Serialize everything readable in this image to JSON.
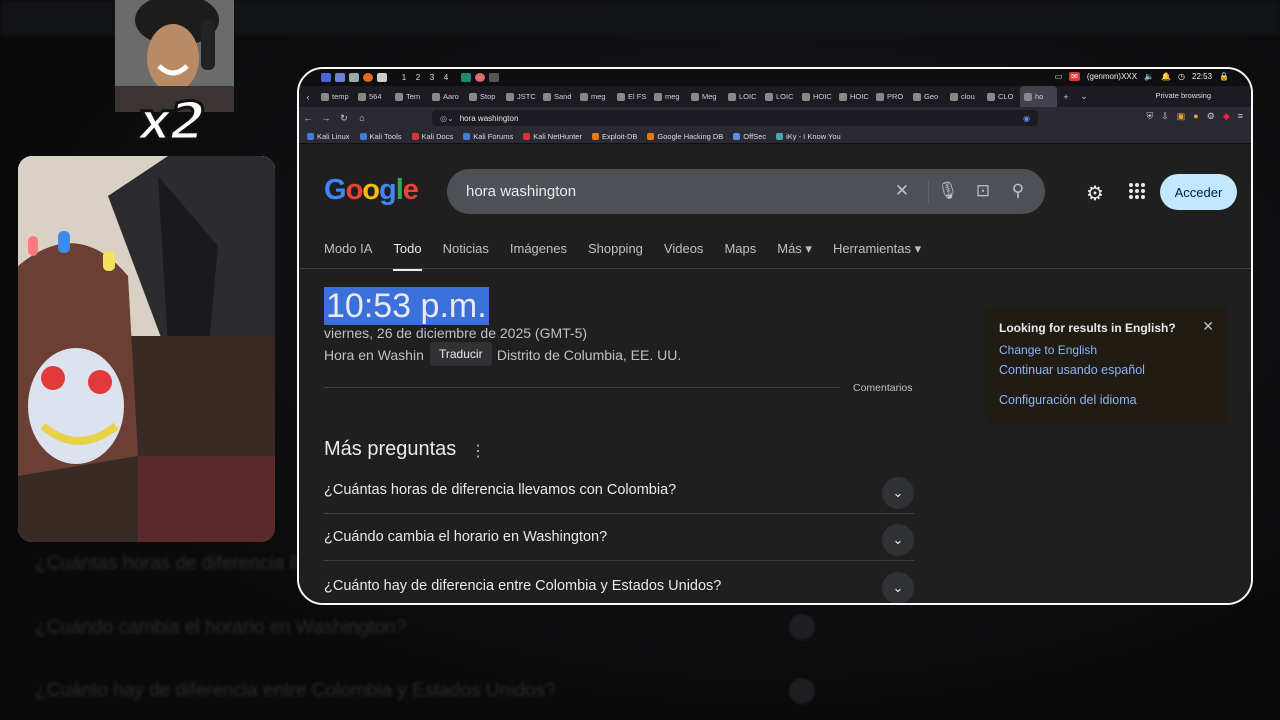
{
  "overlay": {
    "multiplier": "x2"
  },
  "taskbar": {
    "workspaces": [
      "1",
      "2",
      "3",
      "4"
    ],
    "genmon": "(genmon)XXX",
    "time": "22:53"
  },
  "browser": {
    "tabs": [
      "temp",
      "564",
      "Tem",
      "Aaro",
      "Stop",
      "JSTC",
      "Sand",
      "meg",
      "El FS",
      "meg",
      "Meg",
      "LOIC",
      "LOIC",
      "HOIC",
      "HOIC",
      "PRO",
      "Geo",
      "clou",
      "CLO",
      "ho"
    ],
    "active_tab_index": 19,
    "private_label": "Private browsing",
    "url": "hora washington",
    "bookmarks": [
      "Kali Linux",
      "Kali Tools",
      "Kali Docs",
      "Kali Forums",
      "Kali NetHunter",
      "Exploit-DB",
      "Google Hacking DB",
      "OffSec",
      "iKy - I Know You"
    ],
    "bookmark_colors": [
      "#3f7fd9",
      "#3f7fd9",
      "#d33",
      "#3f7fd9",
      "#d33",
      "#e57a12",
      "#e57a12",
      "#5b8fe0",
      "#4aa"
    ]
  },
  "google": {
    "logo_letters": [
      "G",
      "o",
      "o",
      "g",
      "l",
      "e"
    ],
    "query": "hora washington",
    "signin_label": "Acceder",
    "nav_tabs": [
      "Modo IA",
      "Todo",
      "Noticias",
      "Imágenes",
      "Shopping",
      "Videos",
      "Maps",
      "Más ▾",
      "Herramientas ▾"
    ],
    "active_nav": "Todo",
    "time": "10:53 p.m.",
    "date": "viernes, 26 de diciembre de 2025 (GMT-5)",
    "place_prefix": "Hora en Washin",
    "place_suffix": "Distrito de Columbia, EE. UU.",
    "tooltip": "Traducir",
    "feedback": "Comentarios",
    "more_questions": "Más preguntas",
    "questions": [
      "¿Cuántas horas de diferencia llevamos con Colombia?",
      "¿Cuándo cambia el horario en Washington?",
      "¿Cuánto hay de diferencia entre Colombia y Estados Unidos?"
    ],
    "lang_box": {
      "title": "Looking for results in English?",
      "change": "Change to English",
      "continue": "Continuar usando español",
      "settings": "Configuración del idioma"
    }
  },
  "background_ghost": {
    "questions": [
      "¿Cuántas horas de diferencia llevamos con Colombia?",
      "¿Cuándo cambia el horario en Washington?",
      "¿Cuánto hay de diferencia entre Colombia y Estados Unidos?"
    ]
  }
}
